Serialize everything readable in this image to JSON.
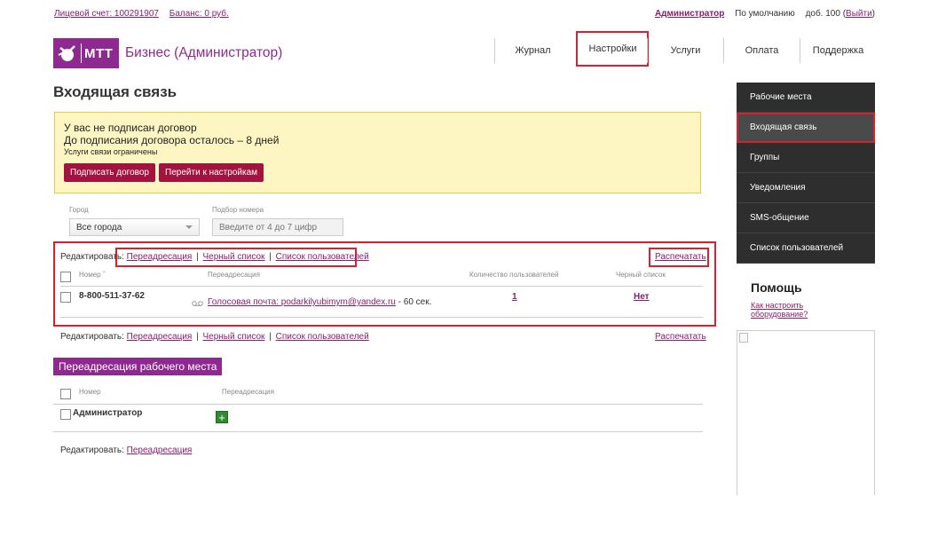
{
  "topbar": {
    "account": "Лицевой счет: 100291907",
    "balance": "Баланс: 0 руб.",
    "admin": "Администратор",
    "default": "По умолчанию",
    "ext_prefix": "доб. 100 (",
    "logout": "Выйти",
    "ext_suffix": ")"
  },
  "logo": {
    "brand": "МТТ",
    "title": "Бизнес (Администратор)"
  },
  "nav": [
    {
      "label": "Журнал"
    },
    {
      "label": "Настройки"
    },
    {
      "label": "Услуги"
    },
    {
      "label": "Оплата"
    },
    {
      "label": "Поддержка"
    }
  ],
  "page_title": "Входящая связь",
  "notice": {
    "line1": "У вас не подписан договор",
    "line2": "До подписания договора осталось – 8 дней",
    "line3": "Услуги связи ограничены",
    "sign_button": "Подписать договор",
    "settings_button": "Перейти к настройкам"
  },
  "filters": {
    "city_label": "Город",
    "city_value": "Все города",
    "number_label": "Подбор номера",
    "number_placeholder": "Введите от 4 до 7 цифр"
  },
  "edit": {
    "label": "Редактировать:",
    "forwarding": "Переадресация",
    "blacklist": "Черный список",
    "users": "Список пользователей",
    "sep": "|",
    "print": "Распечатать"
  },
  "table": {
    "col_number": "Номер",
    "sort_mark": "ˆ",
    "col_forwarding": "Переадресация",
    "col_users": "Количество пользователей",
    "col_blacklist": "Черный список",
    "rows": [
      {
        "number": "8-800-511-37-62",
        "forwarding_prefix": "Голосовая почта: ",
        "forwarding_email": "podarkilyubimym@yandex.ru",
        "forwarding_suffix": " - 60 сек.",
        "users": "1",
        "blacklist": "Нет"
      }
    ]
  },
  "workplace": {
    "title": "Переадресация рабочего места",
    "col_number": "Номер",
    "col_forwarding": "Переадресация",
    "row_name": "Администратор",
    "add": "+",
    "edit_label": "Редактировать:",
    "edit_forwarding": "Переадресация"
  },
  "sidebar": {
    "items": [
      {
        "label": "Рабочие места"
      },
      {
        "label": "Входящая связь"
      },
      {
        "label": "Группы"
      },
      {
        "label": "Уведомления"
      },
      {
        "label": "SMS-общение"
      },
      {
        "label": "Список пользователей"
      }
    ],
    "help_title": "Помощь",
    "help_link": "Как настроить оборудование?"
  },
  "colors": {
    "brand": "#8e2a8f",
    "button": "#a3133f",
    "highlight": "#d4232e",
    "notice_bg": "#fdf6c3"
  }
}
